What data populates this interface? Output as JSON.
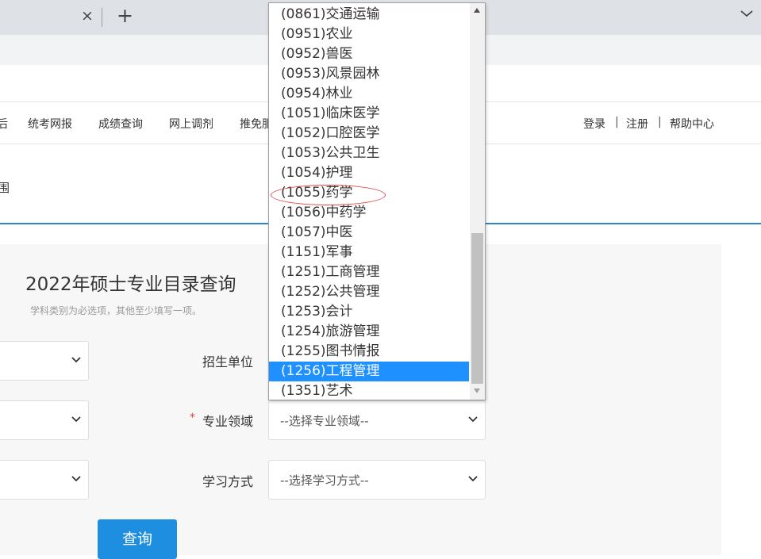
{
  "browser": {
    "tab_close_glyph": "×",
    "new_tab_glyph": "+"
  },
  "nav": {
    "partial_left": "后",
    "items": [
      "统考网报",
      "成绩查询",
      "网上调剂",
      "推免服"
    ],
    "right_links": [
      "登录",
      "注册",
      "帮助中心"
    ],
    "separator": "|"
  },
  "breadcrumb_fragment": "围",
  "page": {
    "title": "2022年硕士专业目录查询",
    "hint": "学科类别为必选项，其他至少填写一项。"
  },
  "form": {
    "institution_label": "招生单位",
    "field_label": "专业领域",
    "required_mark": "*",
    "field_placeholder": "--选择专业领域--",
    "study_mode_label": "学习方式",
    "study_mode_placeholder": "--选择学习方式--",
    "submit_label": "查询"
  },
  "dropdown": {
    "options": [
      "(0861)交通运输",
      "(0951)农业",
      "(0952)兽医",
      "(0953)风景园林",
      "(0954)林业",
      "(1051)临床医学",
      "(1052)口腔医学",
      "(1053)公共卫生",
      "(1054)护理",
      "(1055)药学",
      "(1056)中药学",
      "(1057)中医",
      "(1151)军事",
      "(1251)工商管理",
      "(1252)公共管理",
      "(1253)会计",
      "(1254)旅游管理",
      "(1255)图书情报",
      "(1256)工程管理",
      "(1351)艺术"
    ],
    "highlighted": "(1256)工程管理",
    "circled": "(1055)药学"
  },
  "colors": {
    "accent": "#1e8fe0",
    "selected_option": "#1e90ff",
    "annotation": "#e04848"
  }
}
